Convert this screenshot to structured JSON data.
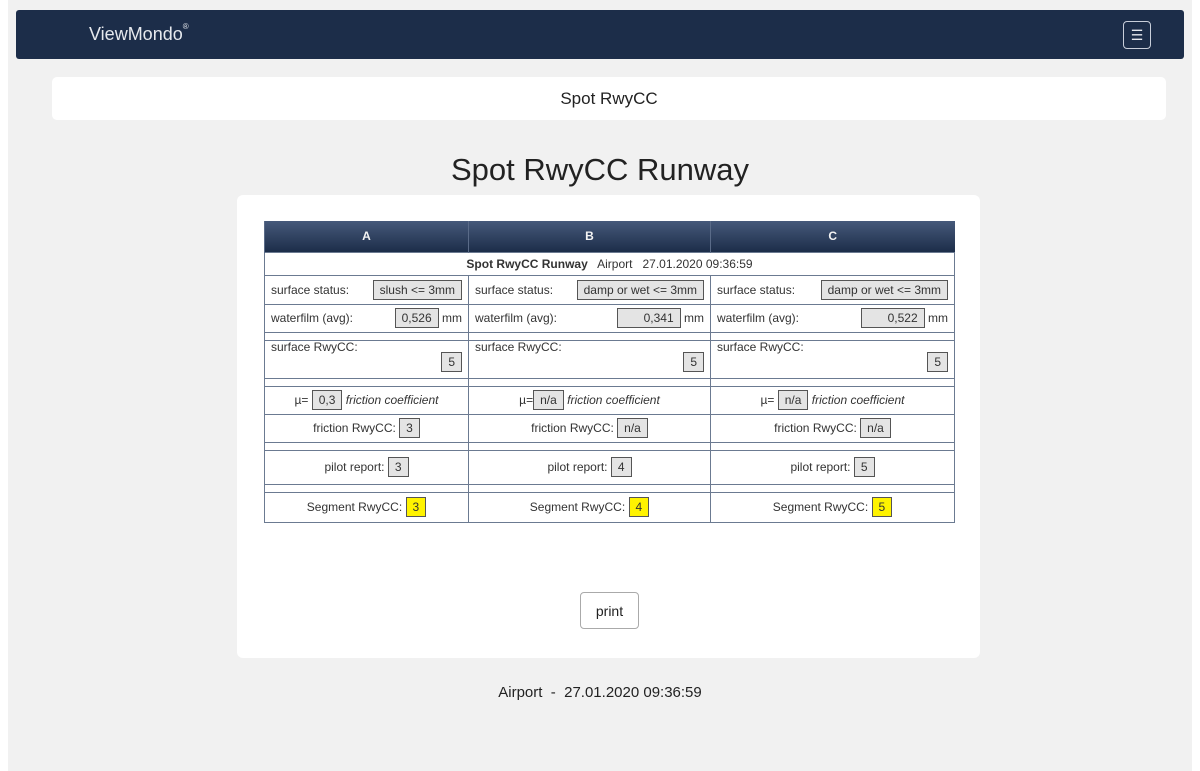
{
  "header": {
    "brand": "ViewMondo",
    "brand_mark": "®",
    "menu_icon": "hamburger-icon"
  },
  "breadcrumb_title": "Spot RwyCC",
  "page_heading": "Spot RwyCC Runway",
  "table": {
    "columns": [
      "A",
      "B",
      "C"
    ],
    "info_title": "Spot RwyCC Runway",
    "info_location": "Airport",
    "info_time": "27.01.2020 09:36:59",
    "labels": {
      "surface_status": "surface status:",
      "waterfilm": "waterfilm (avg):",
      "waterfilm_unit": "mm",
      "surface_rwycc": "surface RwyCC:",
      "mu_prefix": "µ=",
      "friction_coefficient": "friction coefficient",
      "friction_rwycc": "friction RwyCC:",
      "pilot_report": "pilot report:",
      "segment_rwycc": "Segment RwyCC:"
    },
    "segments": [
      {
        "surface_status": "slush <= 3mm",
        "waterfilm": "0,526",
        "surface_rwycc": "5",
        "mu": "0,3",
        "friction_rwycc": "3",
        "pilot_report": "3",
        "segment_rwycc": "3"
      },
      {
        "surface_status": "damp or wet <= 3mm",
        "waterfilm": "0,341",
        "surface_rwycc": "5",
        "mu": "n/a",
        "friction_rwycc": "n/a",
        "pilot_report": "4",
        "segment_rwycc": "4"
      },
      {
        "surface_status": "damp or wet <= 3mm",
        "waterfilm": "0,522",
        "surface_rwycc": "5",
        "mu": "n/a",
        "friction_rwycc": "n/a",
        "pilot_report": "5",
        "segment_rwycc": "5"
      }
    ]
  },
  "print_label": "print",
  "footer": {
    "location": "Airport",
    "separator": "-",
    "timestamp": "27.01.2020 09:36:59"
  },
  "colors": {
    "navbar": "#1c2d49",
    "highlight": "#fff300",
    "background": "#f1f1f1"
  }
}
